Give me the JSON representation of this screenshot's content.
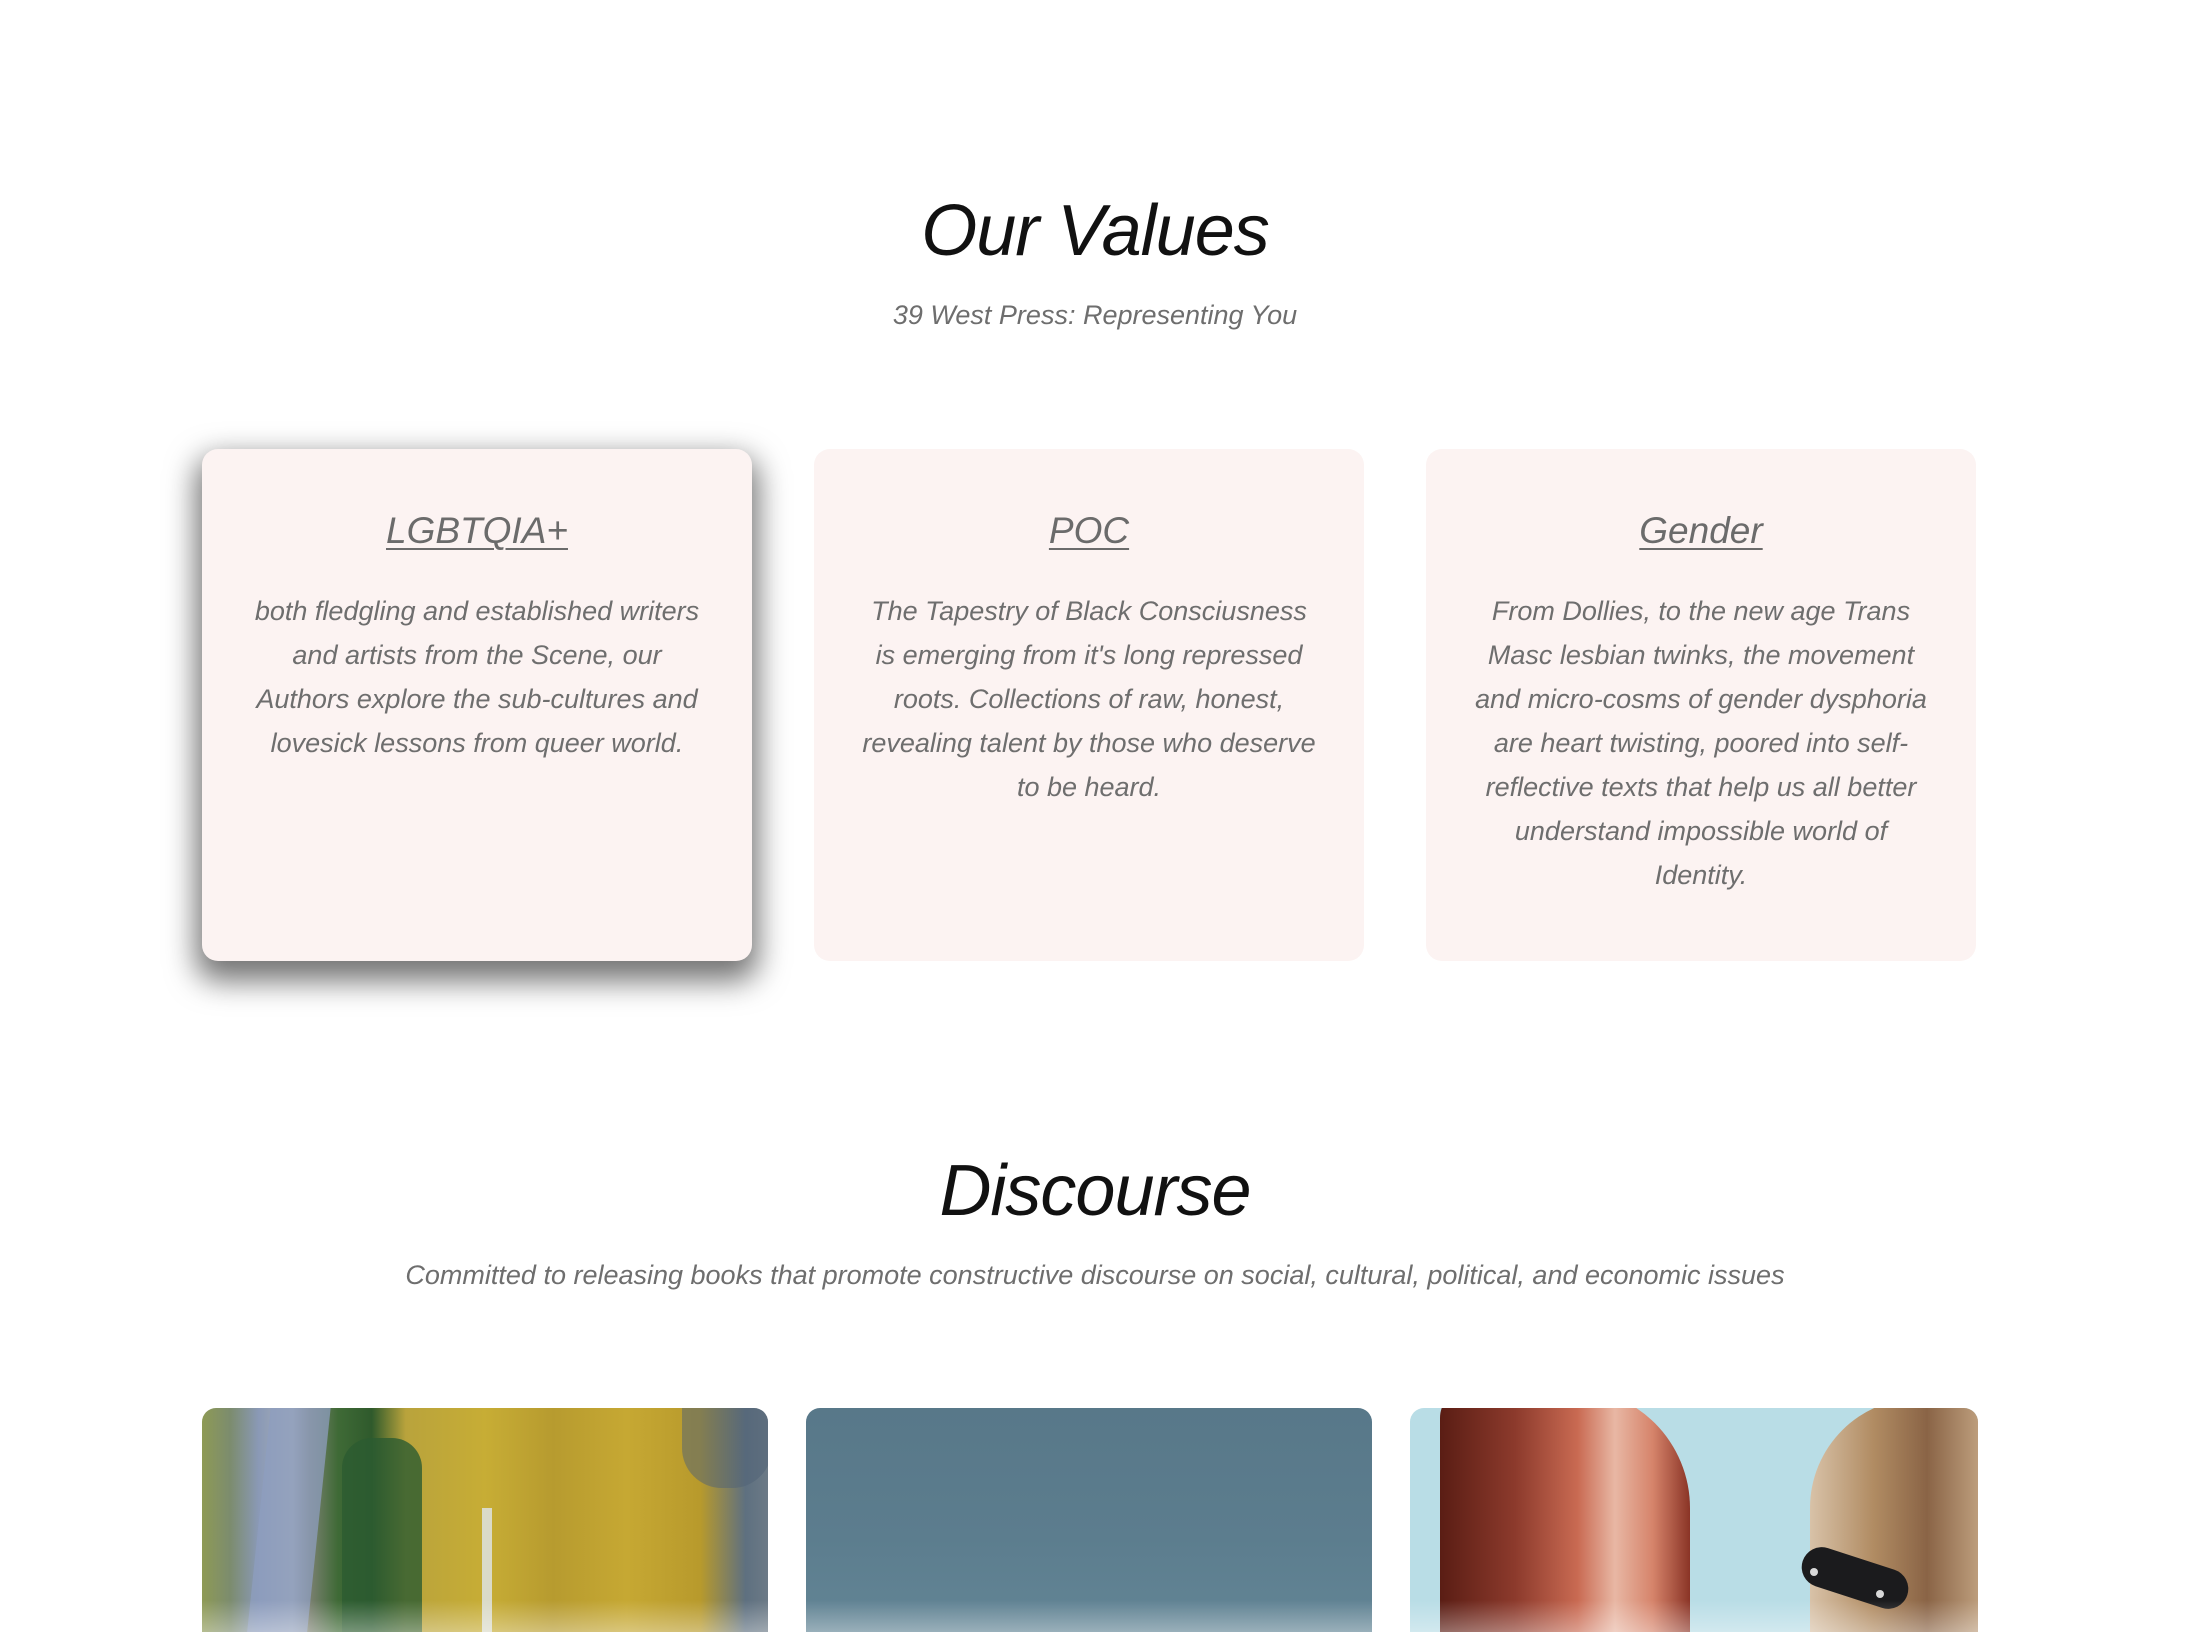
{
  "values_section": {
    "title": "Our Values",
    "subtitle": "39 West Press: Representing You",
    "cards": [
      {
        "title": "LGBTQIA+",
        "body": "both fledgling and established writers and artists from the Scene, our Authors explore the sub-cultures and lovesick lessons from queer world."
      },
      {
        "title": "POC",
        "body": "The Tapestry of Black Consciusness is emerging from it's long repressed roots. Collections of raw, honest, revealing talent by those who deserve to be heard."
      },
      {
        "title": "Gender",
        "body": "From Dollies, to the new age Trans Masc lesbian twinks, the movement and micro-cosms of gender dysphoria are heart twisting, poored into self-reflective texts that help us all better understand impossible world of Identity."
      }
    ]
  },
  "discourse_section": {
    "title": "Discourse",
    "subtitle": "Committed to releasing books that promote constructive discourse on social, cultural, political, and economic issues",
    "images": [
      {
        "name": "painting-image"
      },
      {
        "name": "sky-image"
      },
      {
        "name": "collage-image"
      }
    ]
  },
  "colors": {
    "card_background": "#fcf3f2",
    "heading": "#111111",
    "muted_text": "#6e6e6e"
  }
}
